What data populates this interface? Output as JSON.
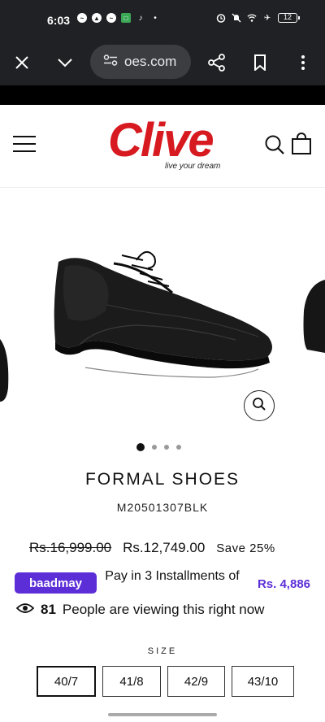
{
  "status_bar": {
    "time": "6:03",
    "battery": "12",
    "left_icons": [
      "messenger-icon",
      "snapchat-icon",
      "messenger-icon",
      "app-icon",
      "tiktok-icon",
      "dot-icon"
    ],
    "right_icons": [
      "alarm-icon",
      "mute-icon",
      "wifi-icon",
      "airplane-icon",
      "battery-icon"
    ]
  },
  "browser": {
    "url": "oes.com",
    "icons": [
      "close-icon",
      "chevron-down-icon",
      "site-settings-icon",
      "share-icon",
      "bookmark-icon",
      "more-icon"
    ]
  },
  "site": {
    "logo_text": "Clive",
    "tagline": "live your dream",
    "brand_color": "#d71920"
  },
  "product": {
    "title": "FORMAL SHOES",
    "sku": "M20501307BLK",
    "old_price": "Rs.16,999.00",
    "new_price": "Rs.12,749.00",
    "save": "Save 25%",
    "image_dots": 4,
    "active_dot": 1
  },
  "installments": {
    "provider": "baadmay",
    "text": "Pay in 3 Installments of",
    "amount": "Rs. 4,886",
    "accent": "#5c2ed8"
  },
  "viewers": {
    "count": "81",
    "text": "People are viewing this right now"
  },
  "size": {
    "label": "SIZE",
    "options": [
      "40/7",
      "41/8",
      "42/9",
      "43/10"
    ],
    "selected": "40/7"
  }
}
